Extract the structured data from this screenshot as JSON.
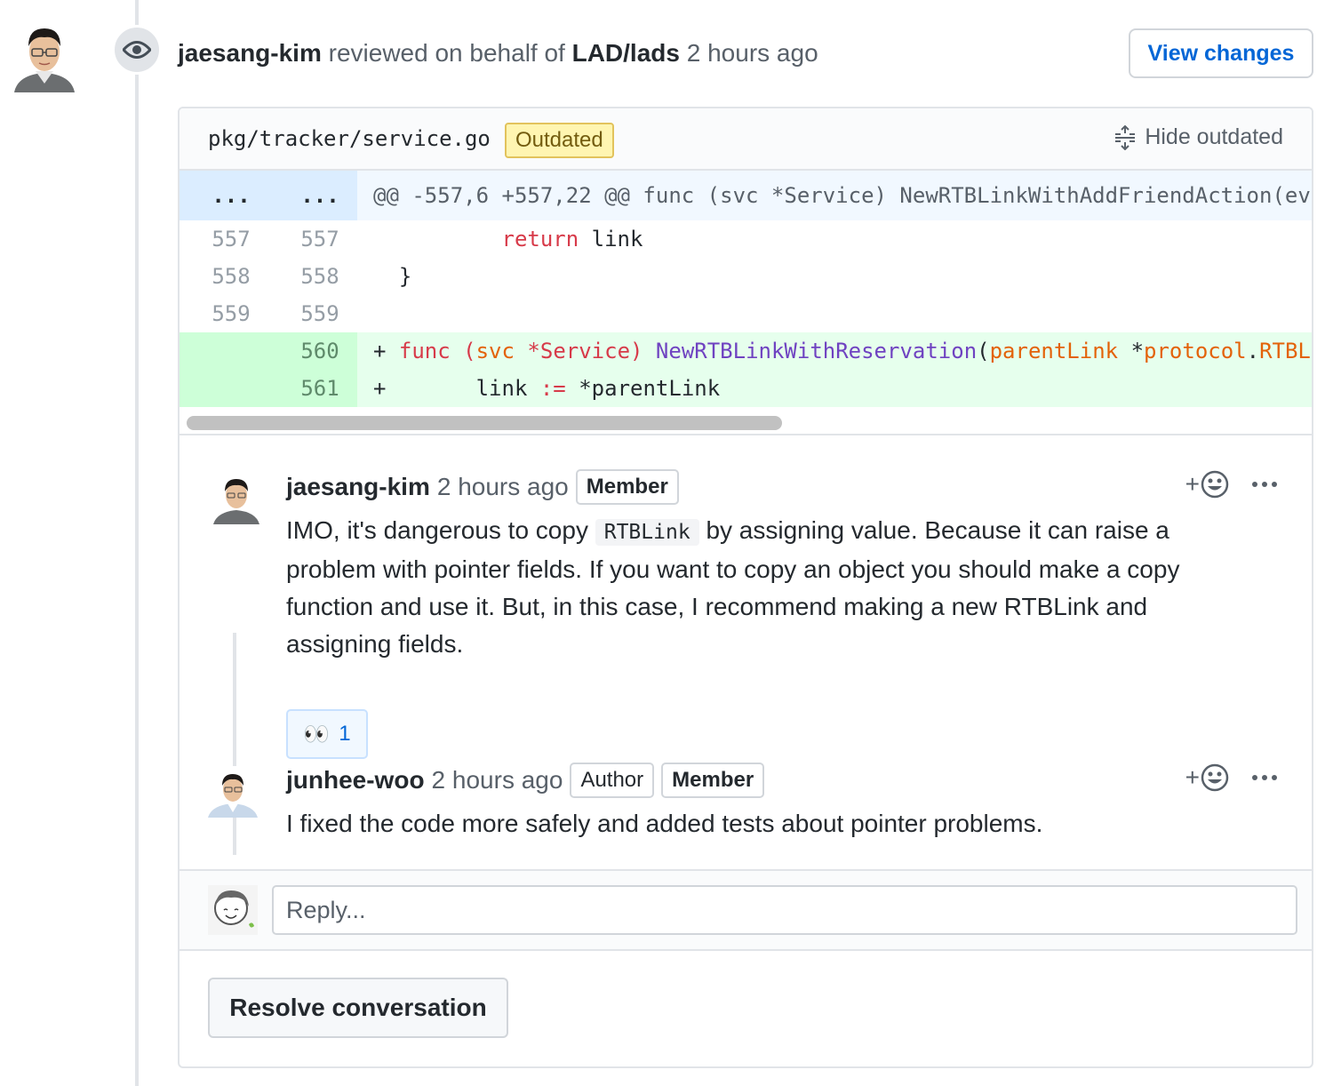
{
  "review": {
    "reviewer": "jaesang-kim",
    "action": "reviewed on behalf of",
    "org": "LAD/lads",
    "time": "2 hours ago",
    "view_changes_label": "View changes"
  },
  "file": {
    "path": "pkg/tracker/service.go",
    "badge": "Outdated",
    "hide_label": "Hide outdated"
  },
  "diff": {
    "hunk_left": "...",
    "hunk_right": "...",
    "hunk_header": "@@ -557,6 +557,22 @@ func (svc *Service) NewRTBLinkWithAddFriendAction(ev",
    "rows": [
      {
        "old": "557",
        "new": "557"
      },
      {
        "old": "558",
        "new": "558"
      },
      {
        "old": "559",
        "new": "559"
      },
      {
        "old": "",
        "new": "560"
      },
      {
        "old": "",
        "new": "561"
      }
    ],
    "tokens": {
      "return_kw": "return",
      "link": "link",
      "brace": "}",
      "plus": "+",
      "func_kw": "func",
      "open_paren": "(",
      "svc": "svc",
      "star_service": "*Service",
      "close_paren": ")",
      "fn_name": "NewRTBLinkWithReservation",
      "paren2": "(",
      "parent_link": "parentLink",
      "star": "*",
      "protocol": "protocol",
      "dot": ".",
      "rtbl": "RTBL",
      "assign": ":=",
      "deref_parent": "*parentLink"
    }
  },
  "comments": [
    {
      "author": "jaesang-kim",
      "time": "2 hours ago",
      "labels": [
        "Member"
      ],
      "body_pre": "IMO, it's dangerous to copy ",
      "body_code": "RTBLink",
      "body_post": " by assigning value. Because it can raise a problem with pointer fields. If you want to copy an object you should make a copy function and use it. But, in this case, I recommend making a new RTBLink and assigning fields.",
      "reaction_emoji": "👀",
      "reaction_count": "1"
    },
    {
      "author": "junhee-woo",
      "time": "2 hours ago",
      "labels": [
        "Author",
        "Member"
      ],
      "body": "I fixed the code more safely and added tests about pointer problems."
    }
  ],
  "reply": {
    "placeholder": "Reply..."
  },
  "resolve_label": "Resolve conversation",
  "icons": {
    "eye": "eye-icon",
    "unfold": "unfold-icon",
    "smiley": "smiley-icon",
    "kebab": "kebab-horizontal-icon"
  },
  "colors": {
    "link_blue": "#0366d6",
    "outdated_bg": "#fff5b1",
    "addition_bg": "#e6ffed",
    "hunk_bg": "#f1f8ff",
    "keyword_red": "#d73a49",
    "function_purple": "#6f42c1",
    "variable_orange": "#e36209"
  }
}
